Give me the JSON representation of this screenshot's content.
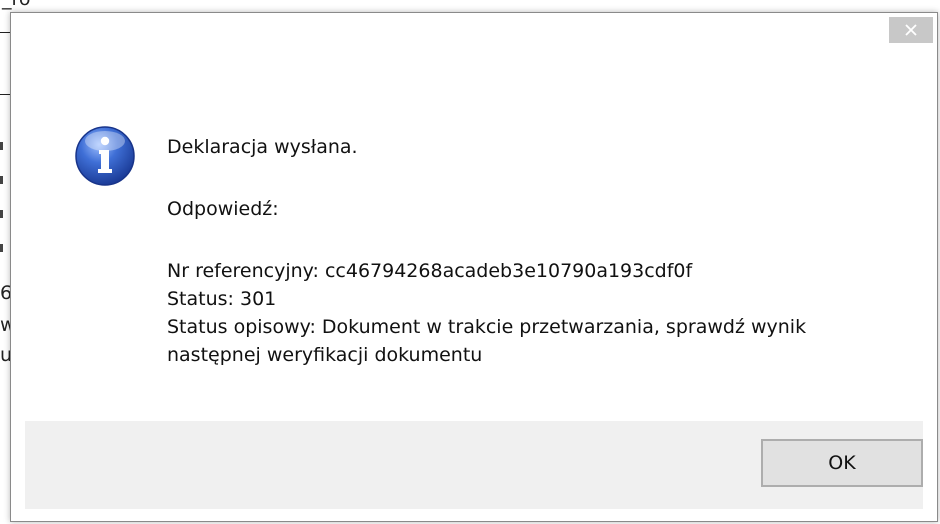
{
  "background_window": {
    "fragment_top": "_ro",
    "fragment_lines": [
      "6",
      "w",
      "u"
    ]
  },
  "dialog": {
    "close_label": "×",
    "icon": "information-icon",
    "message": {
      "line1": "Deklaracja wysłana.",
      "line2": "Odpowiedź:",
      "reference": "Nr referencyjny: cc46794268acadeb3e10790a193cdf0f",
      "status": "Status: 301",
      "status_desc_1": "Status opisowy: Dokument w trakcie przetwarzania, sprawdź wynik",
      "status_desc_2": "następnej weryfikacji dokumentu"
    },
    "ok_label": "OK"
  },
  "colors": {
    "close_bg": "#c8c8c8",
    "footer_bg": "#f0f0f0",
    "icon_blue": "#2f55b8"
  }
}
